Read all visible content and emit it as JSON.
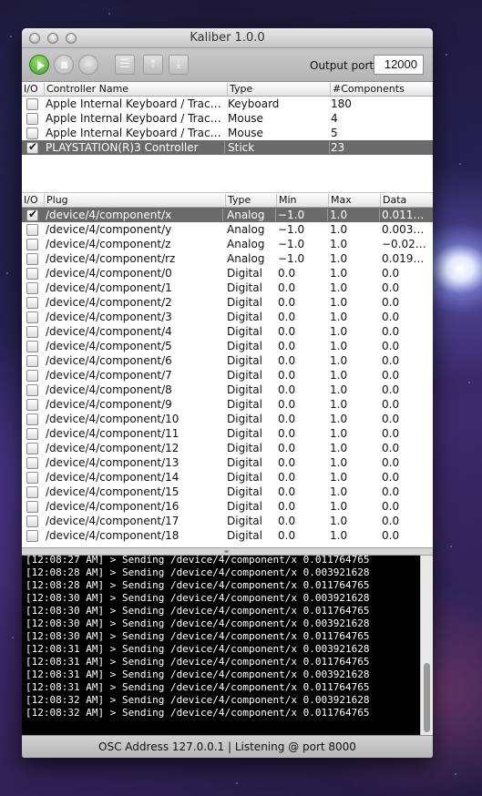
{
  "window": {
    "title": "Kaliber 1.0.0"
  },
  "toolbar": {
    "link_glyph": "∞",
    "doc_glyph": "☰",
    "upload_glyph": "⤒",
    "download_glyph": "⤓",
    "output_port_label": "Output port",
    "output_port_value": "12000"
  },
  "controllers": {
    "columns": [
      "I/O",
      "Controller Name",
      "Type",
      "#Components"
    ],
    "rows": [
      {
        "checked": false,
        "name": "Apple Internal Keyboard / Trackpad",
        "type": "Keyboard",
        "components": "180"
      },
      {
        "checked": false,
        "name": "Apple Internal Keyboard / Trackpad",
        "type": "Mouse",
        "components": "4"
      },
      {
        "checked": false,
        "name": "Apple Internal Keyboard / Trackpad",
        "type": "Mouse",
        "components": "5"
      },
      {
        "checked": true,
        "name": "PLAYSTATION(R)3 Controller",
        "type": "Stick",
        "components": "23",
        "selected": true
      }
    ]
  },
  "plugs": {
    "columns": [
      "I/O",
      "Plug",
      "Type",
      "Min",
      "Max",
      "Data"
    ],
    "rows": [
      {
        "checked": true,
        "plug": "/device/4/component/x",
        "type": "Analog",
        "min": "−1.0",
        "max": "1.0",
        "data": "0.011…",
        "selected": true
      },
      {
        "checked": false,
        "plug": "/device/4/component/y",
        "type": "Analog",
        "min": "−1.0",
        "max": "1.0",
        "data": "0.003…"
      },
      {
        "checked": false,
        "plug": "/device/4/component/z",
        "type": "Analog",
        "min": "−1.0",
        "max": "1.0",
        "data": "−0.02…"
      },
      {
        "checked": false,
        "plug": "/device/4/component/rz",
        "type": "Analog",
        "min": "−1.0",
        "max": "1.0",
        "data": "0.019…"
      },
      {
        "checked": false,
        "plug": "/device/4/component/0",
        "type": "Digital",
        "min": "0.0",
        "max": "1.0",
        "data": "0.0"
      },
      {
        "checked": false,
        "plug": "/device/4/component/1",
        "type": "Digital",
        "min": "0.0",
        "max": "1.0",
        "data": "0.0"
      },
      {
        "checked": false,
        "plug": "/device/4/component/2",
        "type": "Digital",
        "min": "0.0",
        "max": "1.0",
        "data": "0.0"
      },
      {
        "checked": false,
        "plug": "/device/4/component/3",
        "type": "Digital",
        "min": "0.0",
        "max": "1.0",
        "data": "0.0"
      },
      {
        "checked": false,
        "plug": "/device/4/component/4",
        "type": "Digital",
        "min": "0.0",
        "max": "1.0",
        "data": "0.0"
      },
      {
        "checked": false,
        "plug": "/device/4/component/5",
        "type": "Digital",
        "min": "0.0",
        "max": "1.0",
        "data": "0.0"
      },
      {
        "checked": false,
        "plug": "/device/4/component/6",
        "type": "Digital",
        "min": "0.0",
        "max": "1.0",
        "data": "0.0"
      },
      {
        "checked": false,
        "plug": "/device/4/component/7",
        "type": "Digital",
        "min": "0.0",
        "max": "1.0",
        "data": "0.0"
      },
      {
        "checked": false,
        "plug": "/device/4/component/8",
        "type": "Digital",
        "min": "0.0",
        "max": "1.0",
        "data": "0.0"
      },
      {
        "checked": false,
        "plug": "/device/4/component/9",
        "type": "Digital",
        "min": "0.0",
        "max": "1.0",
        "data": "0.0"
      },
      {
        "checked": false,
        "plug": "/device/4/component/10",
        "type": "Digital",
        "min": "0.0",
        "max": "1.0",
        "data": "0.0"
      },
      {
        "checked": false,
        "plug": "/device/4/component/11",
        "type": "Digital",
        "min": "0.0",
        "max": "1.0",
        "data": "0.0"
      },
      {
        "checked": false,
        "plug": "/device/4/component/12",
        "type": "Digital",
        "min": "0.0",
        "max": "1.0",
        "data": "0.0"
      },
      {
        "checked": false,
        "plug": "/device/4/component/13",
        "type": "Digital",
        "min": "0.0",
        "max": "1.0",
        "data": "0.0"
      },
      {
        "checked": false,
        "plug": "/device/4/component/14",
        "type": "Digital",
        "min": "0.0",
        "max": "1.0",
        "data": "0.0"
      },
      {
        "checked": false,
        "plug": "/device/4/component/15",
        "type": "Digital",
        "min": "0.0",
        "max": "1.0",
        "data": "0.0"
      },
      {
        "checked": false,
        "plug": "/device/4/component/16",
        "type": "Digital",
        "min": "0.0",
        "max": "1.0",
        "data": "0.0"
      },
      {
        "checked": false,
        "plug": "/device/4/component/17",
        "type": "Digital",
        "min": "0.0",
        "max": "1.0",
        "data": "0.0"
      },
      {
        "checked": false,
        "plug": "/device/4/component/18",
        "type": "Digital",
        "min": "0.0",
        "max": "1.0",
        "data": "0.0"
      }
    ]
  },
  "log": {
    "lines": [
      "[12:08:27 AM] > Sending /device/4/component/x 0.011764765",
      "[12:08:28 AM] > Sending /device/4/component/x 0.003921628",
      "[12:08:28 AM] > Sending /device/4/component/x 0.011764765",
      "[12:08:30 AM] > Sending /device/4/component/x 0.003921628",
      "[12:08:30 AM] > Sending /device/4/component/x 0.011764765",
      "[12:08:30 AM] > Sending /device/4/component/x 0.003921628",
      "[12:08:30 AM] > Sending /device/4/component/x 0.011764765",
      "[12:08:31 AM] > Sending /device/4/component/x 0.003921628",
      "[12:08:31 AM] > Sending /device/4/component/x 0.011764765",
      "[12:08:31 AM] > Sending /device/4/component/x 0.003921628",
      "[12:08:31 AM] > Sending /device/4/component/x 0.011764765",
      "[12:08:32 AM] > Sending /device/4/component/x 0.003921628",
      "[12:08:32 AM] > Sending /device/4/component/x 0.011764765"
    ]
  },
  "status": {
    "text": "OSC Address 127.0.0.1 | Listening @ port 8000"
  }
}
